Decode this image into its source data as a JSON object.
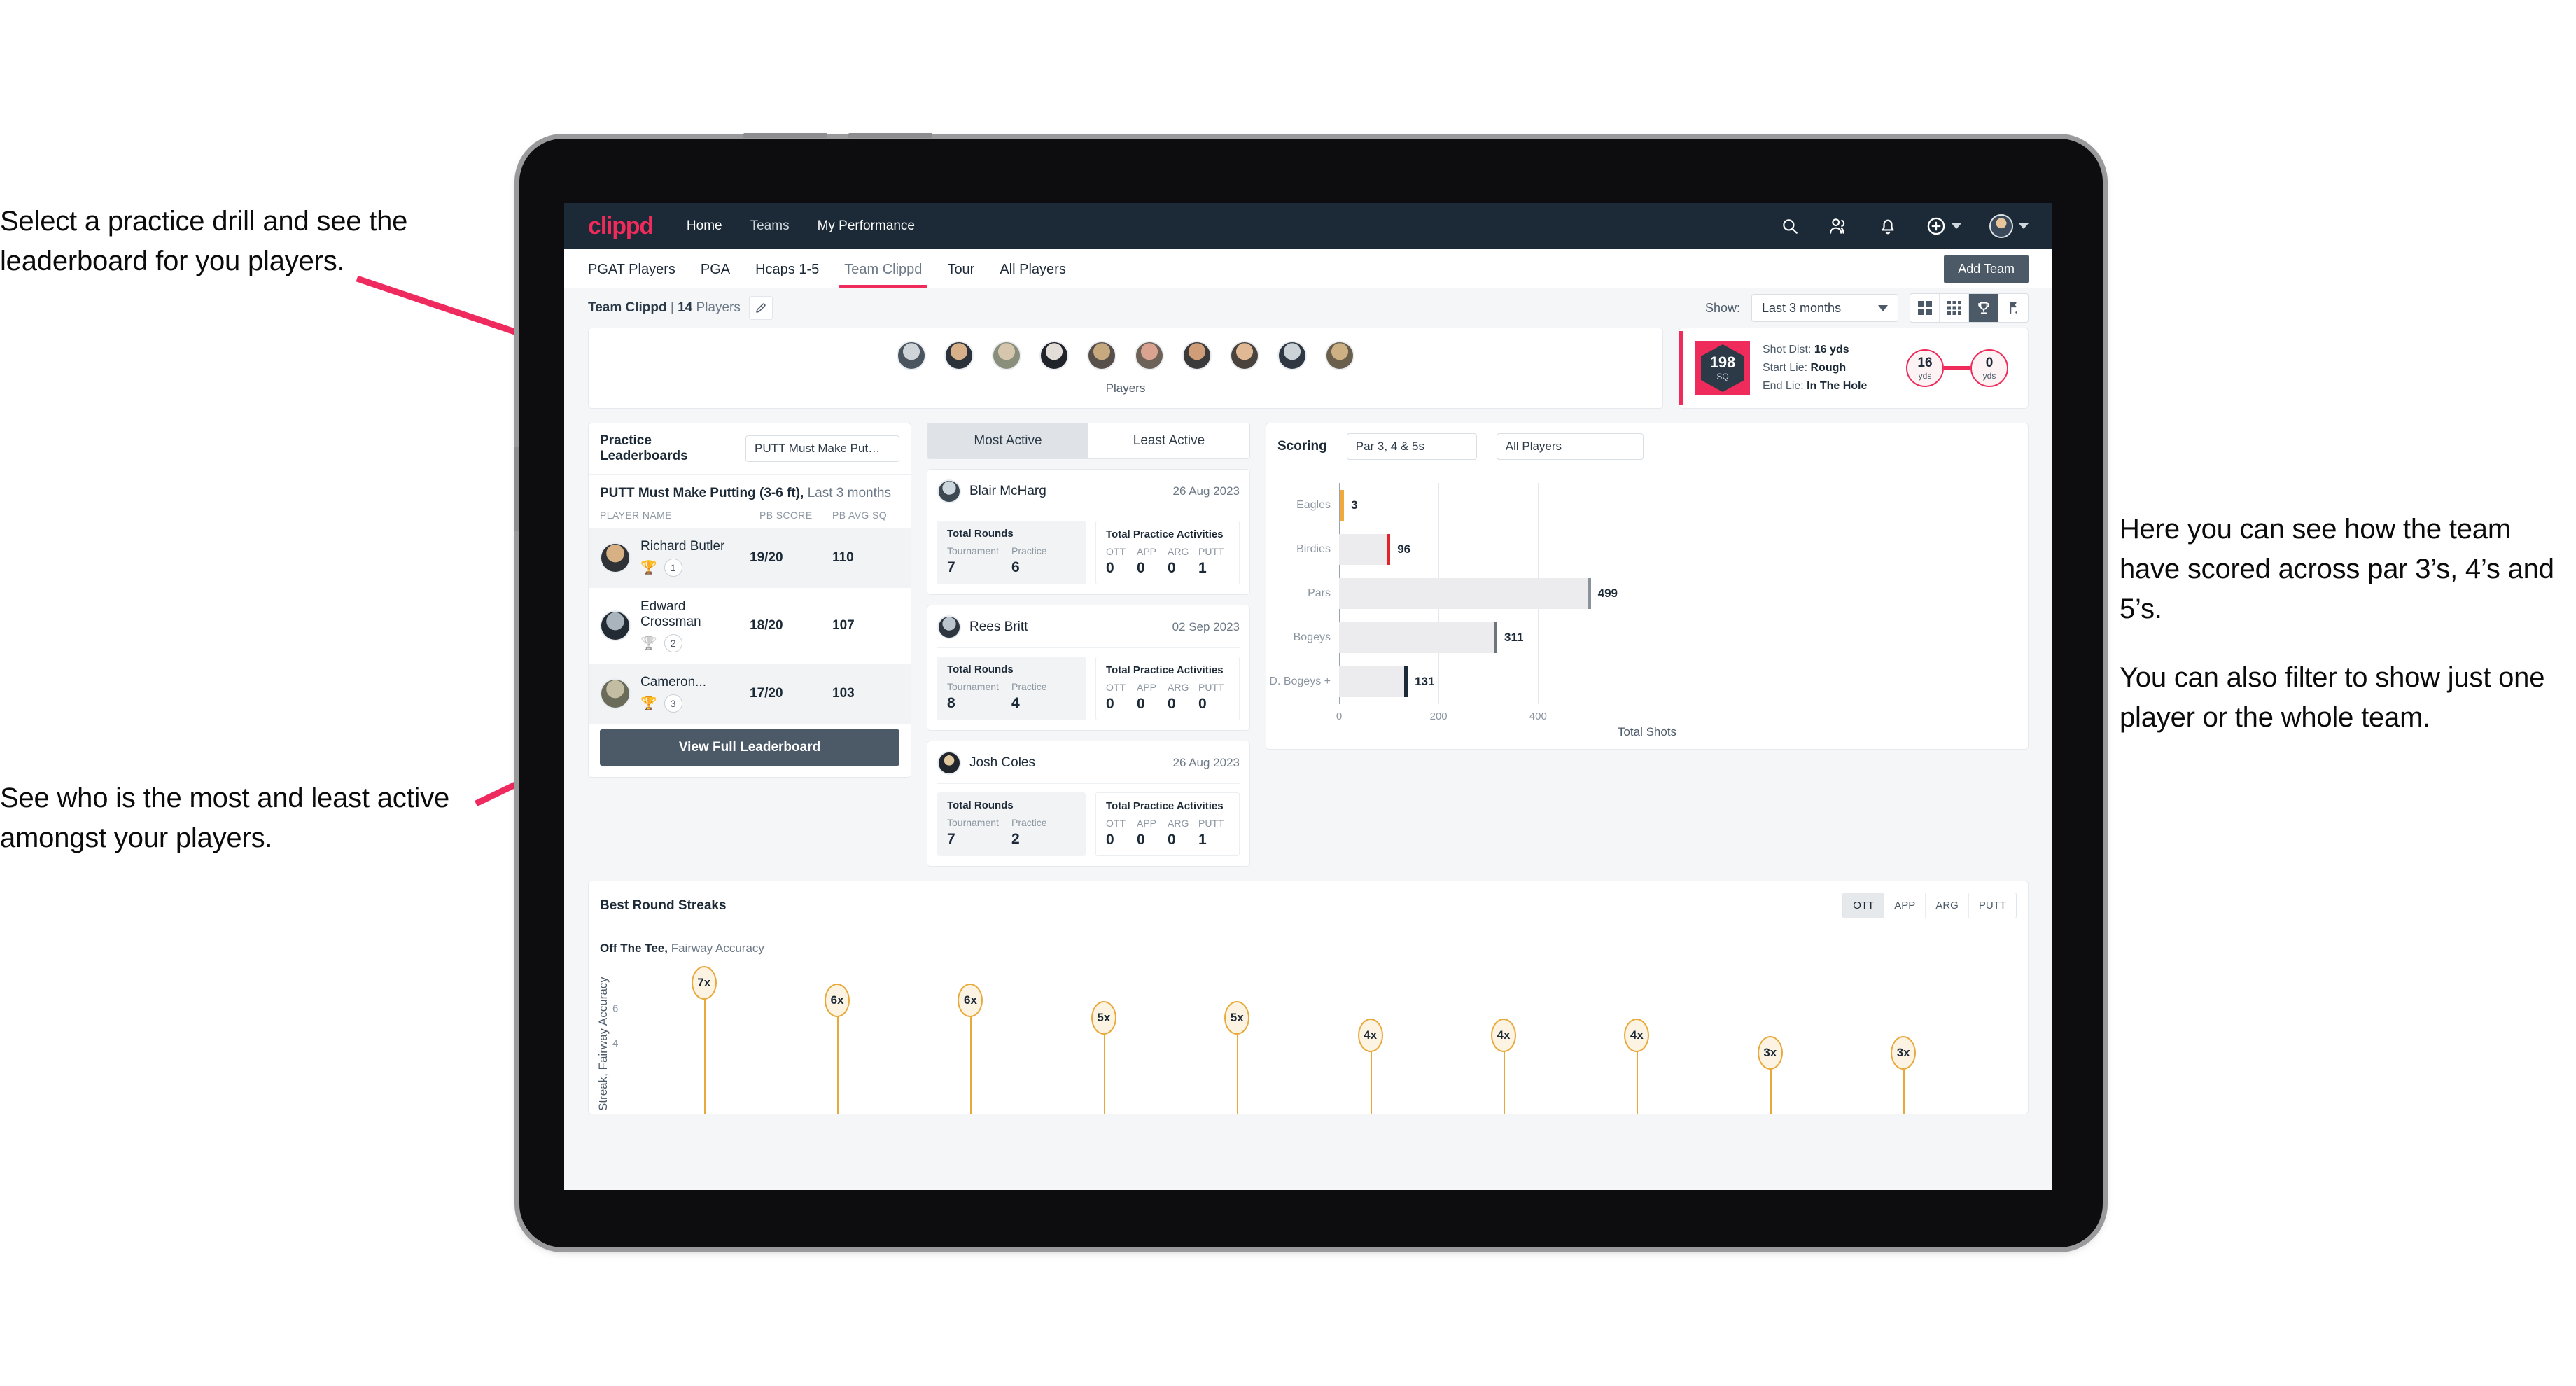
{
  "annotations": {
    "top_left": "Select a practice drill and see the leaderboard for you players.",
    "bottom_left": "See who is the most and least active amongst your players.",
    "right_1": "Here you can see how the team have scored across par 3’s, 4’s and 5’s.",
    "right_2": "You can also filter to show just one player or the whole team.",
    "arrow_color": "#ee2a5f"
  },
  "brand": {
    "logo": "clippd",
    "accent": "#ef2b5b",
    "navbg": "#1c2936"
  },
  "topnav": {
    "links": [
      {
        "label": "Home",
        "active": true
      },
      {
        "label": "Teams",
        "active": false
      },
      {
        "label": "My Performance",
        "active": true
      }
    ],
    "icons": [
      "search-icon",
      "people-icon",
      "bell-icon",
      "plus-circle-icon",
      "avatar"
    ]
  },
  "tabs": [
    {
      "label": "PGAT Players",
      "active": false
    },
    {
      "label": "PGA",
      "active": false
    },
    {
      "label": "Hcaps 1-5",
      "active": false
    },
    {
      "label": "Team Clippd",
      "active": true
    },
    {
      "label": "Tour",
      "active": false
    },
    {
      "label": "All Players",
      "active": false
    }
  ],
  "add_team_button": "Add Team",
  "subbar": {
    "team_name": "Team Clippd",
    "separator": "|",
    "player_count": "14",
    "players_word": "Players",
    "edit_icon": "pencil-icon",
    "show_label": "Show:",
    "range_value": "Last 3 months",
    "view_modes": [
      {
        "name": "grid-view-icon",
        "active": false
      },
      {
        "name": "dots-grid-view-icon",
        "active": false
      },
      {
        "name": "trophy-view-icon",
        "active": true
      },
      {
        "name": "golf-flag-view-icon",
        "active": false
      }
    ]
  },
  "players_strip": {
    "label": "Players",
    "count": 10
  },
  "shot_card": {
    "sq_value": "198",
    "sq_unit": "SQ",
    "shot_dist_label": "Shot Dist:",
    "shot_dist_value": "16 yds",
    "start_lie_label": "Start Lie:",
    "start_lie_value": "Rough",
    "end_lie_label": "End Lie:",
    "end_lie_value": "In The Hole",
    "from_value": "16",
    "from_unit": "yds",
    "to_value": "0",
    "to_unit": "yds"
  },
  "leaderboard": {
    "title": "Practice Leaderboards",
    "drill_select": "PUTT Must Make Putting ...",
    "drill_name": "PUTT Must Make Putting (3-6 ft),",
    "drill_range": "Last 3 months",
    "columns": [
      "PLAYER NAME",
      "PB SCORE",
      "PB AVG SQ"
    ],
    "rows": [
      {
        "name": "Richard Butler",
        "rank": "1",
        "trophy": "gold",
        "pb_score": "19/20",
        "pb_avg_sq": "110"
      },
      {
        "name": "Edward Crossman",
        "rank": "2",
        "trophy": "silver",
        "pb_score": "18/20",
        "pb_avg_sq": "107"
      },
      {
        "name": "Cameron...",
        "rank": "3",
        "trophy": "bronze",
        "pb_score": "17/20",
        "pb_avg_sq": "103"
      }
    ],
    "view_full_button": "View Full Leaderboard"
  },
  "activity": {
    "tabs": [
      {
        "label": "Most Active",
        "active": true
      },
      {
        "label": "Least Active",
        "active": false
      }
    ],
    "rounds_title": "Total Rounds",
    "rounds_cols": [
      "Tournament",
      "Practice"
    ],
    "practice_title": "Total Practice Activities",
    "practice_cols": [
      "OTT",
      "APP",
      "ARG",
      "PUTT"
    ],
    "cards": [
      {
        "name": "Blair McHarg",
        "date": "26 Aug 2023",
        "tournament": "7",
        "practice": "6",
        "ott": "0",
        "app": "0",
        "arg": "0",
        "putt": "1"
      },
      {
        "name": "Rees Britt",
        "date": "02 Sep 2023",
        "tournament": "8",
        "practice": "4",
        "ott": "0",
        "app": "0",
        "arg": "0",
        "putt": "0"
      },
      {
        "name": "Josh Coles",
        "date": "26 Aug 2023",
        "tournament": "7",
        "practice": "2",
        "ott": "0",
        "app": "0",
        "arg": "0",
        "putt": "1"
      }
    ]
  },
  "scoring": {
    "title": "Scoring",
    "par_filter": "Par 3, 4 & 5s",
    "player_filter": "All Players"
  },
  "streaks": {
    "title": "Best Round Streaks",
    "segments": [
      {
        "label": "OTT",
        "active": true
      },
      {
        "label": "APP",
        "active": false
      },
      {
        "label": "ARG",
        "active": false
      },
      {
        "label": "PUTT",
        "active": false
      }
    ],
    "subtitle_bold": "Off The Tee,",
    "subtitle_rest": "Fairway Accuracy"
  },
  "chart_data": [
    {
      "type": "bar",
      "orientation": "horizontal",
      "title": "Scoring",
      "categories": [
        "Eagles",
        "Birdies",
        "Pars",
        "Bogeys",
        "D. Bogeys +"
      ],
      "values": [
        3,
        96,
        499,
        311,
        131
      ],
      "cap_colors": [
        "#f0a93c",
        "#e0242a",
        "#8a929a",
        "#6e757c",
        "#1c2936"
      ],
      "bar_color": "#ececee",
      "xlabel": "Total Shots",
      "ylabel": "",
      "xlim": [
        0,
        560
      ],
      "xticks": [
        0,
        200,
        400
      ],
      "grid": true,
      "legend": "none"
    },
    {
      "type": "scatter",
      "title": "Best Round Streaks",
      "subtitle": "Off The Tee, Fairway Accuracy",
      "ylabel": "Streak, Fairway Accuracy",
      "xlabel": "",
      "ylim": [
        0,
        8
      ],
      "yticks": [
        4,
        6
      ],
      "grid": true,
      "marker": "lollipop-bubble",
      "marker_color": "#e8a93a",
      "categories": [
        "",
        "",
        "",
        "",
        "",
        "",
        "",
        "",
        "",
        ""
      ],
      "values": [
        7,
        6,
        6,
        5,
        5,
        4,
        4,
        4,
        3,
        3
      ],
      "labels": [
        "7x",
        "6x",
        "6x",
        "5x",
        "5x",
        "4x",
        "4x",
        "4x",
        "3x",
        "3x"
      ]
    }
  ]
}
